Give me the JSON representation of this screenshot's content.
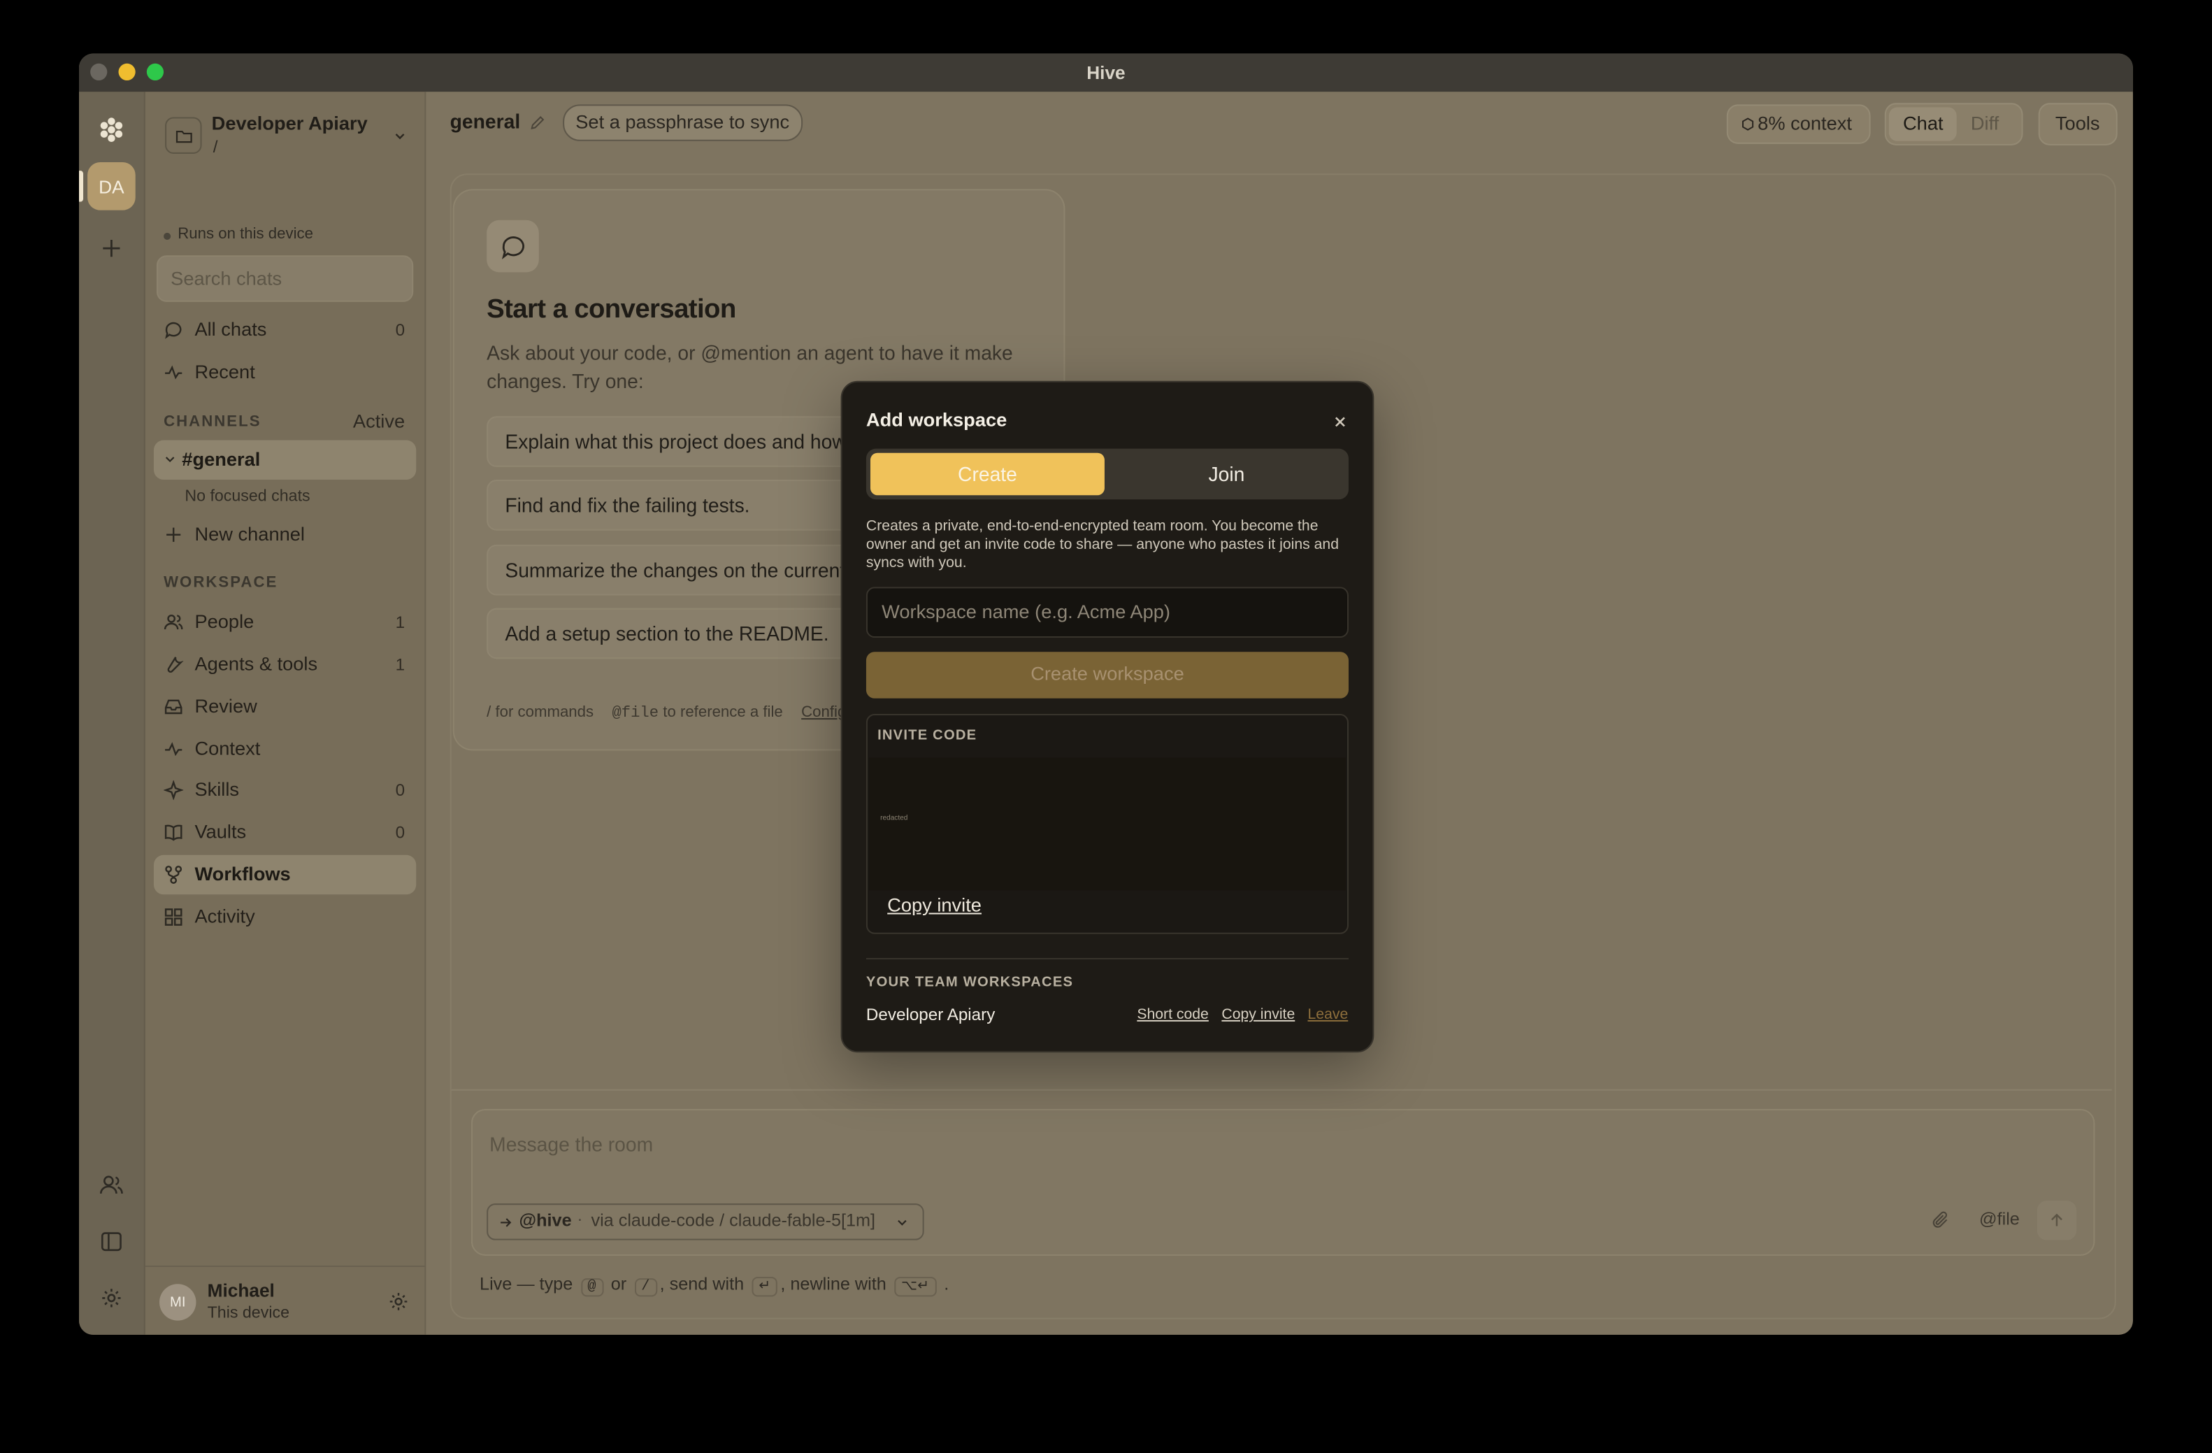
{
  "window": {
    "title": "Hive"
  },
  "rail": {
    "avatar_initials": "DA"
  },
  "workspace": {
    "name": "Developer Apiary",
    "path": "/",
    "status": "Runs on this device"
  },
  "search": {
    "placeholder": "Search chats"
  },
  "nav": {
    "all_chats": {
      "label": "All chats",
      "count": "0"
    },
    "recent": {
      "label": "Recent"
    }
  },
  "channels": {
    "heading": "CHANNELS",
    "filter": "Active",
    "current": "#general",
    "empty_note": "No focused chats",
    "new_channel": "New channel"
  },
  "workspace_section": {
    "heading": "WORKSPACE",
    "items": [
      {
        "label": "People",
        "count": "1",
        "icon": "people-icon"
      },
      {
        "label": "Agents & tools",
        "count": "1",
        "icon": "wrench-icon"
      },
      {
        "label": "Review",
        "count": "",
        "icon": "inbox-icon"
      },
      {
        "label": "Context",
        "count": "",
        "icon": "pulse-icon"
      },
      {
        "label": "Skills",
        "count": "0",
        "icon": "sparkle-icon"
      },
      {
        "label": "Vaults",
        "count": "0",
        "icon": "book-icon"
      },
      {
        "label": "Workflows",
        "count": "",
        "icon": "workflow-icon",
        "active": true
      },
      {
        "label": "Activity",
        "count": "",
        "icon": "grid-icon"
      }
    ]
  },
  "user": {
    "name": "Michael",
    "subtitle": "This device",
    "initials": "MI"
  },
  "header": {
    "channel": "general",
    "passphrase_button": "Set a passphrase to sync",
    "context": "8% context",
    "tabs": [
      "Chat",
      "Diff"
    ],
    "active_tab": "Chat",
    "tools": "Tools"
  },
  "empty_state": {
    "title": "Start a conversation",
    "description": "Ask about your code, or @mention an agent to have it make changes. Try one:",
    "suggestions": [
      "Explain what this project does and how it's structured.",
      "Find and fix the failing tests.",
      "Summarize the changes on the current branch.",
      "Add a setup section to the README."
    ],
    "footer_commands": "/ for commands",
    "footer_file_code": "@file",
    "footer_file_text": "to reference a file",
    "footer_link": "Configure"
  },
  "composer": {
    "placeholder": "Message the room",
    "agent_handle": "@hive",
    "agent_via": "via claude-code / claude-fable-5[1m]",
    "file_button": "@file",
    "hint": {
      "prefix": "Live — type",
      "k1": "@",
      "or": "or",
      "k2": "/",
      "send": ", send with",
      "k3": "↵",
      "newline": ", newline with",
      "k4": "⌥↵",
      "end": "."
    }
  },
  "modal": {
    "title": "Add workspace",
    "tabs": [
      "Create",
      "Join"
    ],
    "active_tab": "Create",
    "description": "Creates a private, end-to-end-encrypted team room. You become the owner and get an invite code to share — anyone who pastes it joins and syncs with you.",
    "name_placeholder": "Workspace name (e.g. Acme App)",
    "create_button": "Create workspace",
    "invite_heading": "INVITE CODE",
    "invite_code": "redacted",
    "copy_invite": "Copy invite",
    "team_heading": "YOUR TEAM WORKSPACES",
    "team_workspaces": [
      {
        "name": "Developer Apiary",
        "short_code": "Short code",
        "copy_invite": "Copy invite",
        "leave": "Leave"
      }
    ]
  },
  "colors": {
    "accent": "#f0c25a",
    "modal_bg": "#1e1b16",
    "window_bg": "#7e7460"
  }
}
